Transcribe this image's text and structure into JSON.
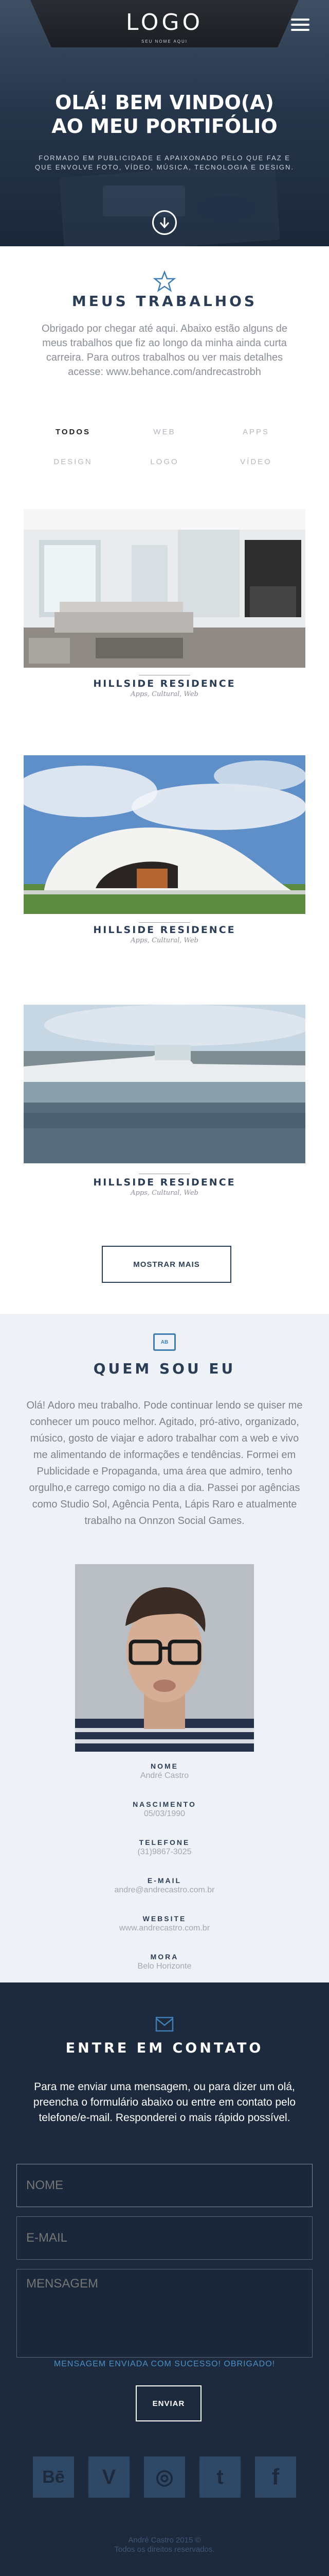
{
  "header": {
    "logo": "LOGO",
    "logo_sub": "SEU NOME AQUI"
  },
  "hero": {
    "title_line1": "OLÁ! BEM VINDO(A)",
    "title_line2": "AO MEU PORTIFÓLIO",
    "subtitle_line1": "FORMADO EM PUBLICIDADE E APAIXONADO PELO QUE FAZ E",
    "subtitle_line2": "QUE ENVOLVE FOTO, VÍDEO, MÚSICA, TECNOLOGIA E DESIGN."
  },
  "works": {
    "heading": "MEUS TRABALHOS",
    "intro_lines": [
      "Obrigado por chegar até aqui. Abaixo estão alguns de",
      "meus trabalhos que fiz ao longo da minha ainda curta",
      "carreira. Para outros trabalhos ou ver mais detalhes",
      "acesse: www.behance.com/andrecastrobh"
    ],
    "filters": [
      "TODOS",
      "WEB",
      "APPS",
      "DESIGN",
      "LOGO",
      "VÍDEO"
    ],
    "active_filter": "TODOS",
    "items": [
      {
        "title": "HILLSIDE RESIDENCE",
        "category": "Apps, Cultural, Web"
      },
      {
        "title": "HILLSIDE RESIDENCE",
        "category": "Apps, Cultural, Web"
      },
      {
        "title": "HILLSIDE RESIDENCE",
        "category": "Apps, Cultural, Web"
      }
    ],
    "more_label": "MOSTRAR MAIS"
  },
  "about": {
    "icon_label": "AB",
    "heading": "QUEM SOU EU",
    "text_lines": [
      "Olá! Adoro meu trabalho. Pode continuar lendo se quiser me",
      "conhecer um pouco melhor. Agitado, pró-ativo, organizado,",
      "músico, gosto de viajar e adoro trabalhar com a web e vivo",
      "me alimentando de informações e tendências. Formei em",
      "Publicidade e Propaganda, uma área que admiro, tenho",
      "orgulho,e carrego comigo no dia a dia. Passei por agências",
      "como Studio Sol, Agência Penta, Lápis Raro e atualmente",
      "trabalho na Onnzon Social Games."
    ],
    "info": [
      {
        "label": "NOME",
        "value": "André Castro"
      },
      {
        "label": "NASCIMENTO",
        "value": "05/03/1990"
      },
      {
        "label": "TELEFONE",
        "value": "(31)9867-3025"
      },
      {
        "label": "E-MAIL",
        "value": "andre@andrecastro.com.br"
      },
      {
        "label": "WEBSITE",
        "value": "www.andrecastro.com.br"
      },
      {
        "label": "MORA",
        "value": "Belo Horizonte"
      }
    ]
  },
  "contact": {
    "heading": "ENTRE EM CONTATO",
    "text_lines": [
      "Para me enviar uma mensagem, ou para dizer um olá,",
      "preencha o formulário abaixo ou entre em contato pelo",
      "telefone/e-mail. Responderei o mais rápido possível."
    ],
    "name_placeholder": "NOME",
    "email_placeholder": "E-MAIL",
    "message_placeholder": "MENSAGEM",
    "success": "MENSAGEM ENVIADA COM SUCESSO! OBRIGADO!",
    "send_label": "ENVIAR",
    "socials": [
      "Bē",
      "V",
      "◎",
      "t",
      "f"
    ]
  },
  "footer": {
    "line1": "André Castro 2015 ©",
    "line2": "Todos os direitos reservados."
  },
  "colors": {
    "navy": "#2b3c55",
    "contact_bg": "#1d2a3d",
    "about_bg": "#eef1f6",
    "accent": "#4a90c7"
  }
}
